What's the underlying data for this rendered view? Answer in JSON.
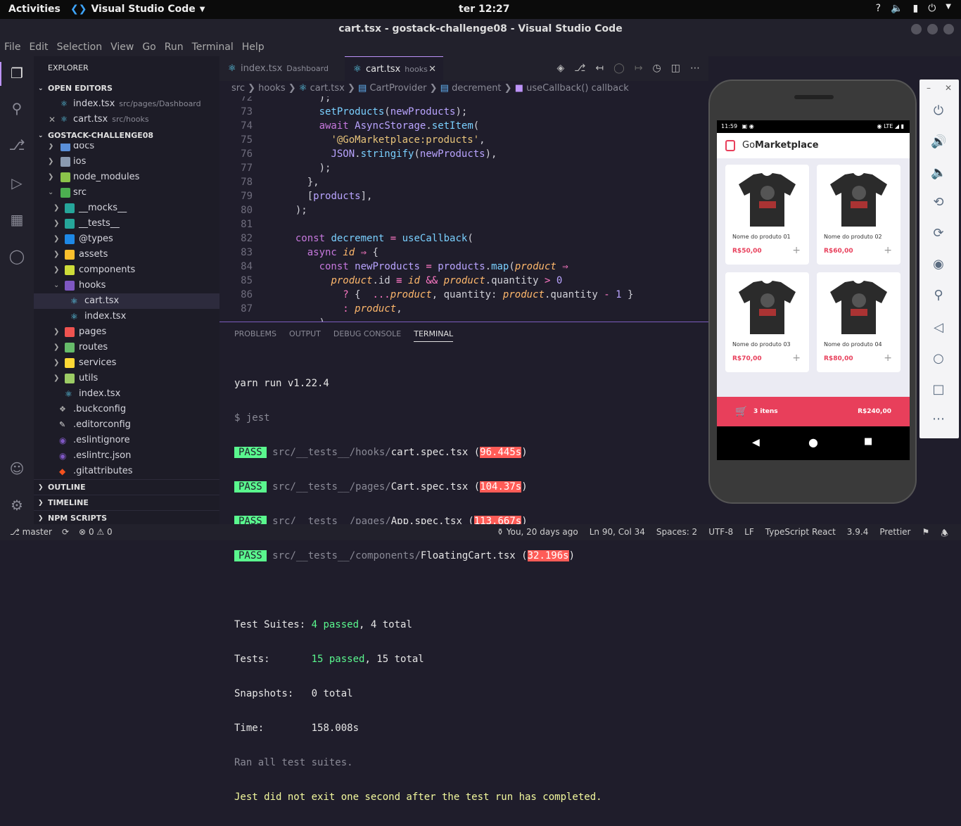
{
  "system": {
    "activities": "Activities",
    "app_name": "Visual Studio Code",
    "clock": "ter 12:27"
  },
  "window": {
    "title": "cart.tsx - gostack-challenge08 - Visual Studio Code"
  },
  "menu": [
    "File",
    "Edit",
    "Selection",
    "View",
    "Go",
    "Run",
    "Terminal",
    "Help"
  ],
  "sidebar": {
    "explorer_title": "EXPLORER",
    "open_editors_title": "OPEN EDITORS",
    "open_editors": [
      {
        "name": "index.tsx",
        "path": "src/pages/Dashboard"
      },
      {
        "name": "cart.tsx",
        "path": "src/hooks"
      }
    ],
    "project_title": "GOSTACK-CHALLENGE08",
    "tree": [
      {
        "label": "docs"
      },
      {
        "label": "ios"
      },
      {
        "label": "node_modules"
      },
      {
        "label": "src"
      },
      {
        "label": "__mocks__"
      },
      {
        "label": "__tests__"
      },
      {
        "label": "@types"
      },
      {
        "label": "assets"
      },
      {
        "label": "components"
      },
      {
        "label": "hooks"
      },
      {
        "label": "cart.tsx"
      },
      {
        "label": "index.tsx"
      },
      {
        "label": "pages"
      },
      {
        "label": "routes"
      },
      {
        "label": "services"
      },
      {
        "label": "utils"
      },
      {
        "label": "index.tsx"
      },
      {
        "label": ".buckconfig"
      },
      {
        "label": ".editorconfig"
      },
      {
        "label": ".eslintignore"
      },
      {
        "label": ".eslintrc.json"
      },
      {
        "label": ".gitattributes"
      }
    ],
    "outline_title": "OUTLINE",
    "timeline_title": "TIMELINE",
    "npm_title": "NPM SCRIPTS"
  },
  "tabs": [
    {
      "name": "index.tsx",
      "desc": "Dashboard"
    },
    {
      "name": "cart.tsx",
      "desc": "hooks"
    }
  ],
  "breadcrumbs": [
    "src",
    "hooks",
    "cart.tsx",
    "CartProvider",
    "decrement",
    "useCallback() callback"
  ],
  "editor": {
    "line_numbers": [
      "72",
      "73",
      "74",
      "75",
      "76",
      "77",
      "78",
      "79",
      "80",
      "81",
      "82",
      "83",
      "84",
      "85",
      "86",
      "87"
    ]
  },
  "panel": {
    "tabs": [
      "PROBLEMS",
      "OUTPUT",
      "DEBUG CONSOLE",
      "TERMINAL"
    ],
    "terminal": {
      "header": "yarn run v1.22.4",
      "command": "$ jest",
      "pass_label": "PASS",
      "results": [
        {
          "dir": "src/__tests__/hooks/",
          "file": "cart.spec.tsx",
          "time": "96.445s"
        },
        {
          "dir": "src/__tests__/pages/",
          "file": "Cart.spec.tsx",
          "time": "104.37s"
        },
        {
          "dir": "src/__tests__/pages/",
          "file": "App.spec.tsx",
          "time": "113.667s"
        },
        {
          "dir": "src/__tests__/components/",
          "file": "FloatingCart.tsx",
          "time": "32.196s"
        }
      ],
      "suites_label": "Test Suites:",
      "suites_passed": "4 passed",
      "suites_total": ", 4 total",
      "tests_label": "Tests:",
      "tests_passed": "15 passed",
      "tests_total": ", 15 total",
      "snap_label": "Snapshots:",
      "snap_value": "0 total",
      "time_label": "Time:",
      "time_value": "158.008s",
      "ran": "Ran all test suites.",
      "warning": "Jest did not exit one second after the test run has completed."
    }
  },
  "statusbar": {
    "branch": "master",
    "problems": "0 ⚠ 0",
    "blame": "You, 20 days ago",
    "position": "Ln 90, Col 34",
    "spaces": "Spaces: 2",
    "encoding": "UTF-8",
    "eol": "LF",
    "language": "TypeScript React",
    "ts_version": "3.9.4",
    "formatter": "Prettier"
  },
  "emulator": {
    "time": "11:59",
    "network": "LTE",
    "app_title_prefix": "Go",
    "app_title_bold": "Marketplace",
    "products": [
      {
        "name": "Nome do produto 01",
        "price": "R$50,00"
      },
      {
        "name": "Nome do produto 02",
        "price": "R$60,00"
      },
      {
        "name": "Nome do produto 03",
        "price": "R$70,00"
      },
      {
        "name": "Nome do produto 04",
        "price": "R$80,00"
      }
    ],
    "cart_items": "3 itens",
    "cart_total": "R$240,00",
    "accent_color": "#e83f5b"
  }
}
